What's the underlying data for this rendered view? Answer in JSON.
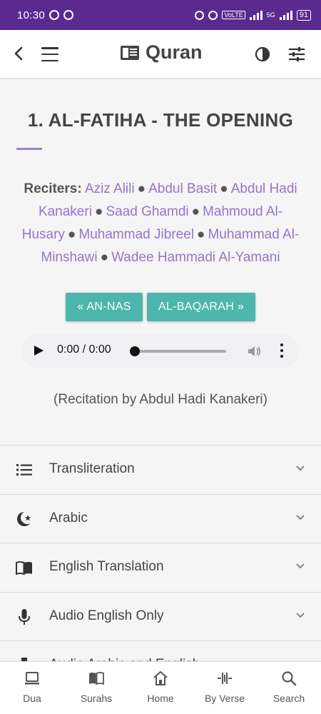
{
  "status_bar": {
    "time": "10:30",
    "network": "5G",
    "battery": "91"
  },
  "app_bar": {
    "title": "Quran",
    "icons": [
      "back-arrow-icon",
      "menu-icon",
      "book-icon",
      "contrast-icon",
      "tune-icon"
    ]
  },
  "surah": {
    "title": "1. AL-FATIHA - THE OPENING",
    "reciters_label": "Reciters:",
    "reciters": [
      "Aziz Alili",
      "Abdul Basit",
      "Abdul Hadi Kanakeri",
      "Saad Ghamdi",
      "Mahmoud Al-Husary",
      "Muhammad Jibreel",
      "Muhammad Al-Minshawi",
      "Wadee Hammadi Al-Yamani"
    ],
    "separator": "●",
    "prev_button": "« AN-NAS",
    "next_button": "AL-BAQARAH »",
    "recitation_note": "(Recitation by Abdul Hadi Kanakeri)"
  },
  "audio": {
    "time": "0:00 / 0:00",
    "progress": 0
  },
  "accordion": [
    {
      "label": "Transliteration",
      "icon": "list-icon"
    },
    {
      "label": "Arabic",
      "icon": "crescent-star-icon"
    },
    {
      "label": "English Translation",
      "icon": "open-book-icon"
    },
    {
      "label": "Audio English Only",
      "icon": "microphone-icon"
    },
    {
      "label": "Audio Arabic and English",
      "icon": "audio-icon"
    }
  ],
  "bottom_nav": [
    {
      "label": "Dua",
      "icon": "laptop-icon"
    },
    {
      "label": "Surahs",
      "icon": "book-open-icon"
    },
    {
      "label": "Home",
      "icon": "home-icon"
    },
    {
      "label": "By Verse",
      "icon": "verse-icon"
    },
    {
      "label": "Search",
      "icon": "search-icon"
    }
  ],
  "colors": {
    "status_bar": "#5a2a8e",
    "accent_purple": "#9574c7",
    "button_teal": "#4db6ac"
  }
}
